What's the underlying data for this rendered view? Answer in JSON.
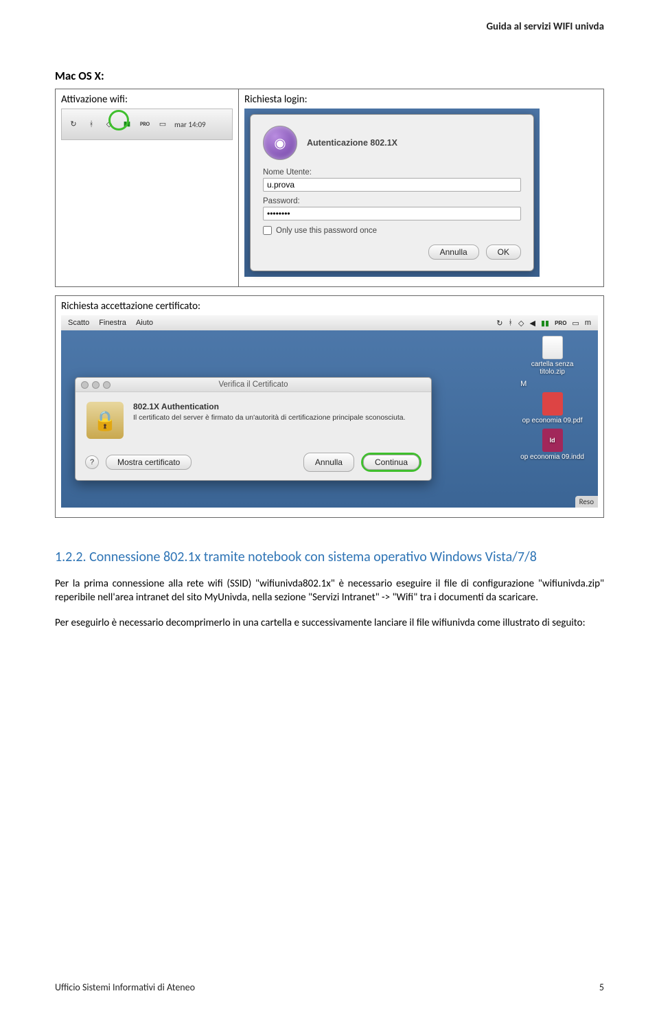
{
  "header": "Guida al servizi WIFI univda",
  "section_label": "Mac OS X:",
  "cell_activation": "Attivazione wifi:",
  "cell_login": "Richiesta login:",
  "cell_cert": "Richiesta accettazione certificato:",
  "menubar": {
    "time": "mar 14:09",
    "pro": "PRO"
  },
  "login": {
    "title": "Autenticazione 802.1X",
    "username_label": "Nome Utente:",
    "username_value": "u.prova",
    "password_label": "Password:",
    "password_value": "••••••••",
    "checkbox_label": "Only use this password once",
    "cancel": "Annulla",
    "ok": "OK"
  },
  "topmenu": {
    "scatto": "Scatto",
    "finestra": "Finestra",
    "aiuto": "Aiuto",
    "pro": "PRO",
    "right_letter": "m"
  },
  "desk": {
    "zip_label": "cartella senza titolo.zip",
    "pdf_label": "op economia 09.pdf",
    "indd_label": "op economia 09.indd",
    "indd_tag": "Id",
    "m": "M",
    "reso": "Reso"
  },
  "cert": {
    "window_title": "Verifica il Certificato",
    "heading": "802.1X Authentication",
    "subtext": "Il certificato del server è firmato da un'autorità di certificazione principale sconosciuta.",
    "help": "?",
    "show": "Mostra certificato",
    "cancel": "Annulla",
    "continue": "Continua"
  },
  "h2_full": "1.2.2. Connessione 802.1x tramite notebook con sistema operativo Windows Vista/7/8",
  "p1": "Per la prima connessione alla rete wifi (SSID) \"wifiunivda802.1x\" è necessario eseguire il file di configurazione \"wifiunivda.zip\" reperibile nell'area intranet del sito MyUnivda, nella sezione \"Servizi Intranet\" -> \"Wifi\" tra i documenti da scaricare.",
  "p2": "Per eseguirlo è necessario decomprimerlo in una cartella e successivamente lanciare il file wifiunivda come illustrato di seguito:",
  "footer": {
    "left": "Ufficio Sistemi Informativi di Ateneo",
    "right": "5"
  }
}
